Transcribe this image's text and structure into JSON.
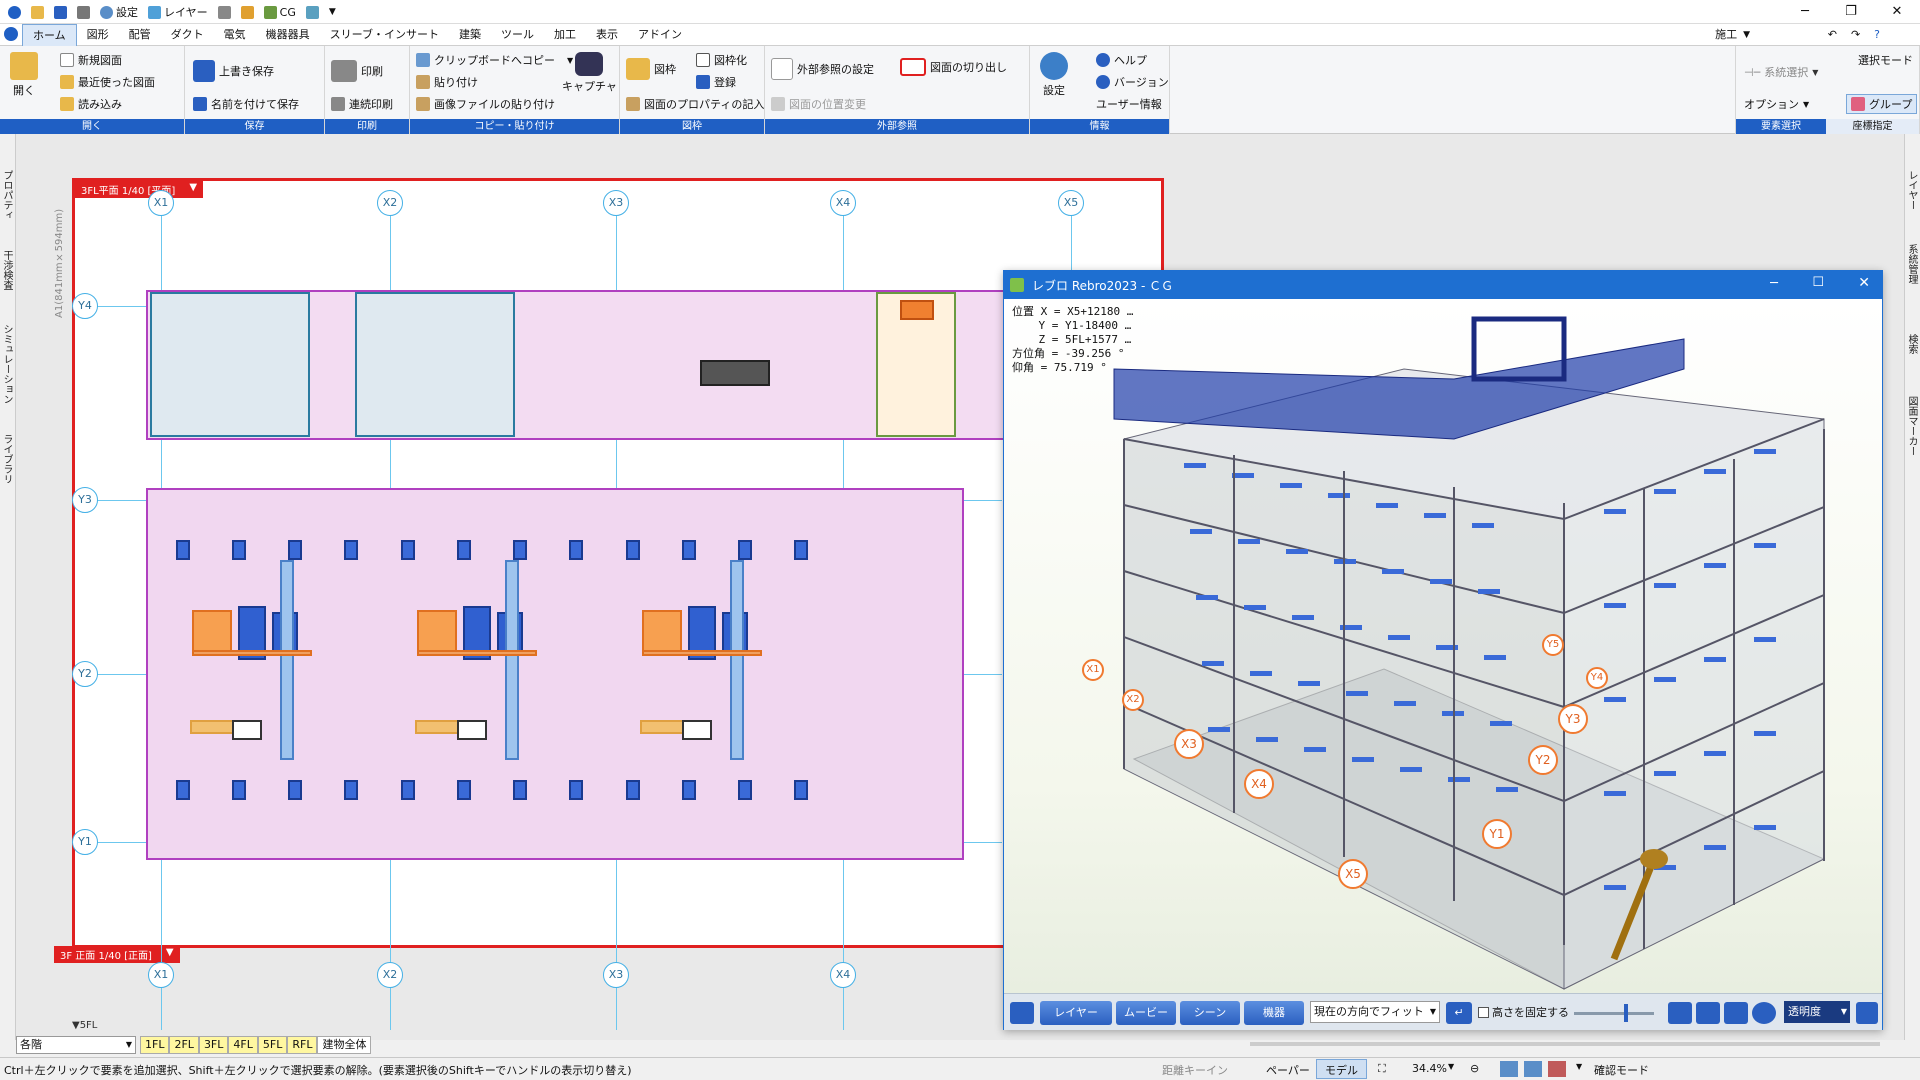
{
  "qa": {
    "settings": "設定",
    "layer": "レイヤー",
    "cg": "CG"
  },
  "menu": [
    "ホーム",
    "図形",
    "配管",
    "ダクト",
    "電気",
    "機器器具",
    "スリーブ・インサート",
    "建築",
    "ツール",
    "加工",
    "表示",
    "アドイン"
  ],
  "menu_right": {
    "mode": "施工"
  },
  "ribbon": {
    "open": {
      "label": "開く",
      "new": "新規図面",
      "recent": "最近使った図面",
      "load": "読み込み",
      "caption": "開く"
    },
    "save": {
      "overwrite": "上書き保存",
      "saveas": "名前を付けて保存",
      "caption": "保存"
    },
    "print": {
      "print": "印刷",
      "continuous": "連続印刷",
      "caption": "印刷"
    },
    "copy": {
      "clip": "クリップボードへコピー",
      "paste": "貼り付け",
      "pasteimg": "画像ファイルの貼り付け",
      "capture": "キャプチャ",
      "caption": "コピー・貼り付け"
    },
    "frame": {
      "frame": "図枠",
      "frameize": "図枠化",
      "register": "登録",
      "props": "図面のプロパティの記入",
      "caption": "図枠"
    },
    "xref": {
      "setting": "外部参照の設定",
      "cut": "図面の切り出し",
      "position": "図面の位置変更",
      "caption": "外部参照"
    },
    "info": {
      "settings": "設定",
      "help": "ヘルプ",
      "version": "バージョン",
      "user": "ユーザー情報",
      "caption": "情報"
    },
    "select": {
      "system": "系統選択",
      "option": "オプション",
      "mode": "選択モード",
      "group": "グループ",
      "caption": "要素選択",
      "coord": "座標指定"
    }
  },
  "left_tabs": [
    "プロパティ",
    "干渉検査",
    "シミュレーション",
    "ライブラリ"
  ],
  "right_tabs": [
    "レイヤー",
    "系統管理",
    "検索",
    "図面マーカー"
  ],
  "drawing": {
    "plan_label": "3FL平面 1/40 [平面]",
    "elev_label": "3F 正面 1/40 [正面]",
    "paper_size": "A1(841mm×594mm)",
    "floor_marker": "▼5FL"
  },
  "grid": {
    "x": [
      "X1",
      "X2",
      "X3",
      "X4",
      "X5"
    ],
    "y": [
      "Y4",
      "Y3",
      "Y2",
      "Y1"
    ]
  },
  "cg": {
    "title": "レブロ Rebro2023 - ＣＧ",
    "info": [
      "位置 X = X5+12180 …",
      "    Y = Y1-18400 …",
      "    Z = 5FL+1577 …",
      "方位角 = -39.256 °",
      "仰角 = 75.719 °"
    ],
    "toolbar": {
      "layer": "レイヤー",
      "movie": "ムービー",
      "scene": "シーン",
      "equip": "機器",
      "fit": "現在の方向でフィット",
      "fixheight": "高さを固定する",
      "transparency": "透明度"
    },
    "axes": [
      "X1",
      "X2",
      "X3",
      "X4",
      "X5",
      "Y1",
      "Y2",
      "Y3",
      "Y4",
      "Y5"
    ]
  },
  "floors": {
    "select": "各階",
    "tabs": [
      "1FL",
      "2FL",
      "3FL",
      "4FL",
      "5FL",
      "RFL",
      "建物全体"
    ]
  },
  "status": {
    "hint": "Ctrl＋左クリックで要素を追加選択、Shift＋左クリックで選択要素の解除。(要素選択後のShiftキーでハンドルの表示切り替え)",
    "distance": "距離キーイン",
    "paper": "ペーパー",
    "model": "モデル",
    "zoom": "34.4%",
    "confirm": "確認モード"
  },
  "colors": {
    "ribbon_caption": "#1f5fc4",
    "frame": "#e02020",
    "room": "#f1d7f0",
    "grid": "#6cc7ee",
    "cg_title": "#1e6fd1"
  }
}
